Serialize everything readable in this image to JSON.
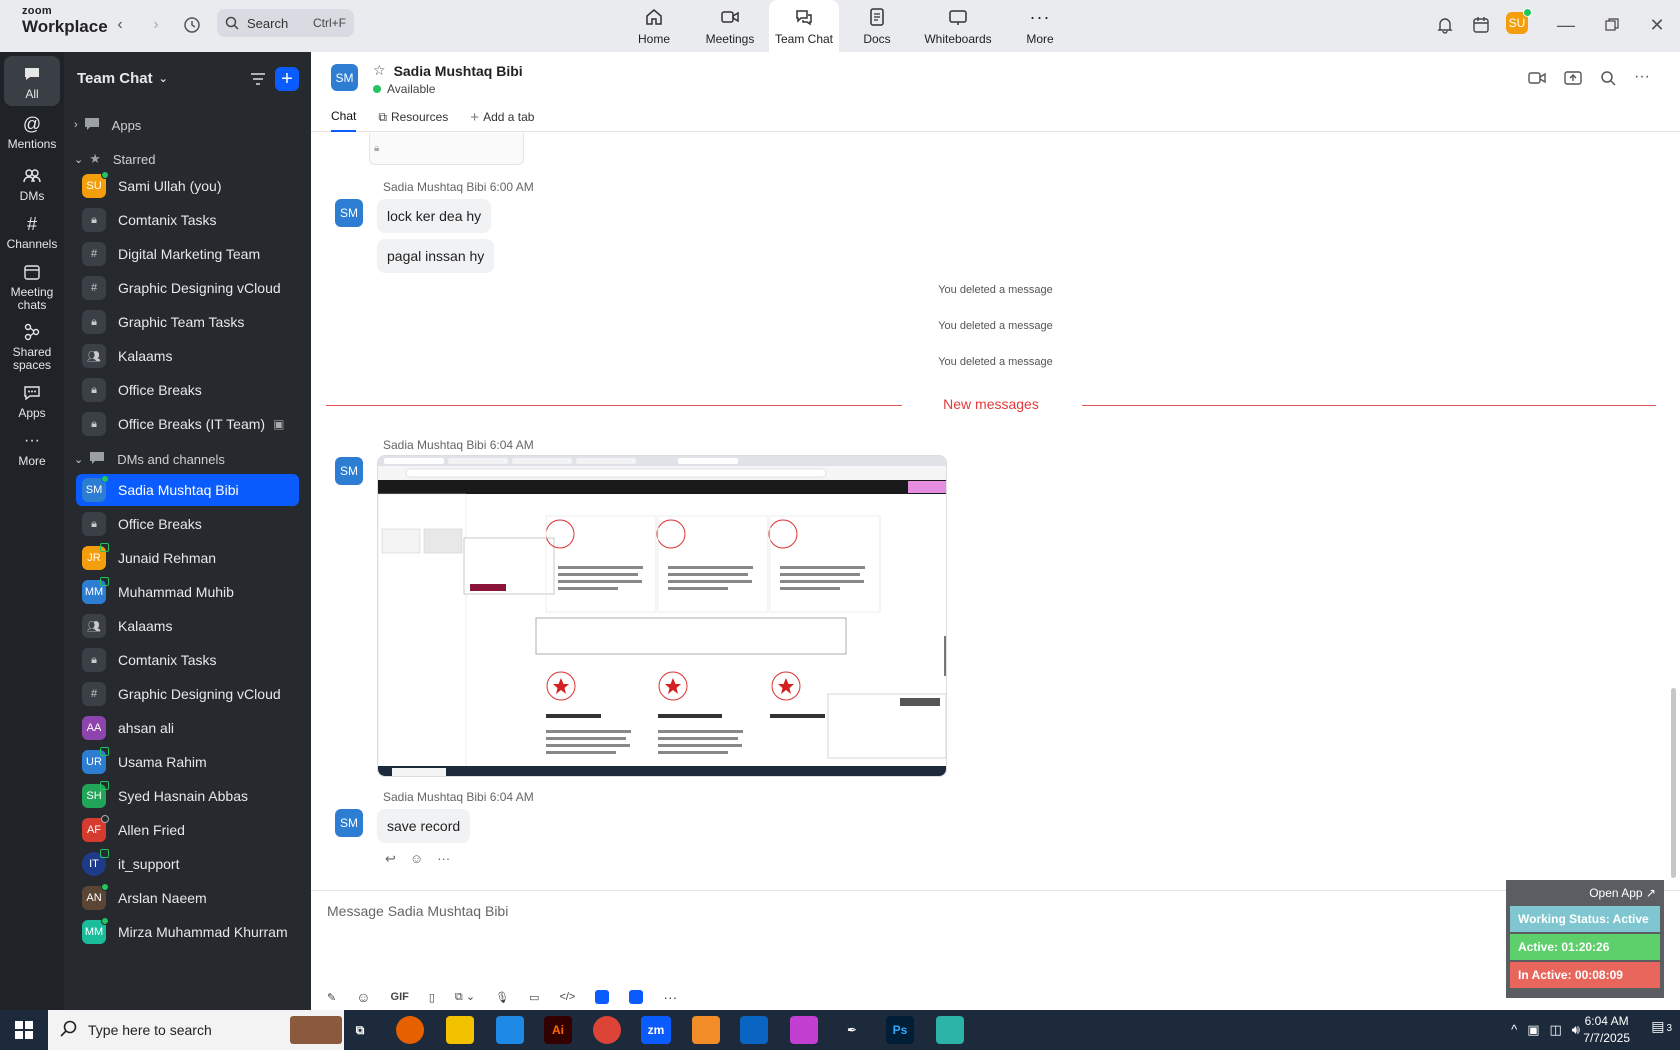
{
  "app": {
    "logo_line1": "zoom",
    "logo_line2": "Workplace"
  },
  "search": {
    "placeholder": "Search",
    "shortcut": "Ctrl+F"
  },
  "top_tabs": [
    {
      "label": "Home",
      "icon": "home-icon"
    },
    {
      "label": "Meetings",
      "icon": "video-icon"
    },
    {
      "label": "Team Chat",
      "icon": "chat-icon"
    },
    {
      "label": "Docs",
      "icon": "doc-icon"
    },
    {
      "label": "Whiteboards",
      "icon": "whiteboard-icon"
    },
    {
      "label": "More",
      "icon": "more-icon"
    }
  ],
  "user": {
    "initials": "SU",
    "color": "#f59e0b"
  },
  "rail": [
    {
      "label": "All",
      "icon": "chat-bubble-icon"
    },
    {
      "label": "Mentions",
      "icon": "at-icon"
    },
    {
      "label": "DMs",
      "icon": "people-icon"
    },
    {
      "label": "Channels",
      "icon": "hash-icon"
    },
    {
      "label": "Meeting chats",
      "icon": "calendar-icon"
    },
    {
      "label": "Shared spaces",
      "icon": "shared-icon"
    },
    {
      "label": "Apps",
      "icon": "apps-icon"
    },
    {
      "label": "More",
      "icon": "more-icon"
    }
  ],
  "sidebar": {
    "title": "Team Chat",
    "sections": {
      "apps": "Apps",
      "starred": "Starred",
      "dms": "DMs and channels"
    },
    "starred": [
      {
        "name": "Sami Ullah (you)",
        "initials": "SU",
        "color": "#f59e0b",
        "kind": "avatar"
      },
      {
        "name": "Comtanix Tasks",
        "kind": "lock"
      },
      {
        "name": "Digital Marketing Team",
        "kind": "hash"
      },
      {
        "name": "Graphic Designing vCloud",
        "kind": "hash"
      },
      {
        "name": "Graphic Team Tasks",
        "kind": "lock"
      },
      {
        "name": "Kalaams",
        "kind": "group"
      },
      {
        "name": "Office Breaks",
        "kind": "lock"
      },
      {
        "name": "Office Breaks (IT Team)",
        "kind": "lock"
      }
    ],
    "dms": [
      {
        "name": "Sadia Mushtaq Bibi",
        "initials": "SM",
        "color": "#2d7dd2",
        "kind": "avatar"
      },
      {
        "name": "Office Breaks",
        "kind": "lock"
      },
      {
        "name": "Junaid Rehman",
        "initials": "JR",
        "color": "#f59e0b",
        "kind": "avatar"
      },
      {
        "name": "Muhammad Muhib",
        "initials": "MM",
        "color": "#2d7dd2",
        "kind": "avatar"
      },
      {
        "name": "Kalaams",
        "kind": "group"
      },
      {
        "name": "Comtanix Tasks",
        "kind": "lock"
      },
      {
        "name": "Graphic Designing vCloud",
        "kind": "hash"
      },
      {
        "name": "ahsan ali",
        "initials": "AA",
        "color": "#8e44ad",
        "kind": "avatar"
      },
      {
        "name": "Usama Rahim",
        "initials": "UR",
        "color": "#2d7dd2",
        "kind": "avatar"
      },
      {
        "name": "Syed Hasnain Abbas",
        "initials": "SH",
        "color": "#22a559",
        "kind": "avatar"
      },
      {
        "name": "Allen Fried",
        "initials": "AF",
        "color": "#d63b2f",
        "kind": "avatar"
      },
      {
        "name": "it_support",
        "initials": "IT",
        "color": "#1e3a8a",
        "kind": "avatar"
      },
      {
        "name": "Arslan Naeem",
        "initials": "AN",
        "color": "#5b4636",
        "kind": "avatar"
      },
      {
        "name": "Mirza Muhammad Khurram",
        "initials": "MM",
        "color": "#1abc9c",
        "kind": "avatar"
      }
    ]
  },
  "chat": {
    "name": "Sadia Mushtaq Bibi",
    "initials": "SM",
    "status": "Available",
    "tabs": {
      "chat": "Chat",
      "resources": "Resources",
      "add": "Add a tab"
    },
    "sender": "Sadia Mushtaq Bibi",
    "t1": "6:00 AM",
    "t2": "6:04 AM",
    "t3": "6:04 AM",
    "m1": "lock ker dea hy",
    "m2": "pagal inssan hy",
    "deleted": "You deleted a message",
    "new_messages": "New messages",
    "m3": "save record",
    "composer_placeholder": "Message Sadia Mushtaq Bibi",
    "gif": "GIF"
  },
  "widget": {
    "open": "Open App ↗",
    "status": "Working Status: Active",
    "active": "Active: 01:20:26",
    "inactive": "In Active: 00:08:09"
  },
  "taskbar": {
    "search": "Type here to search",
    "time": "6:04 AM",
    "date": "7/7/2025",
    "notif": "3"
  }
}
